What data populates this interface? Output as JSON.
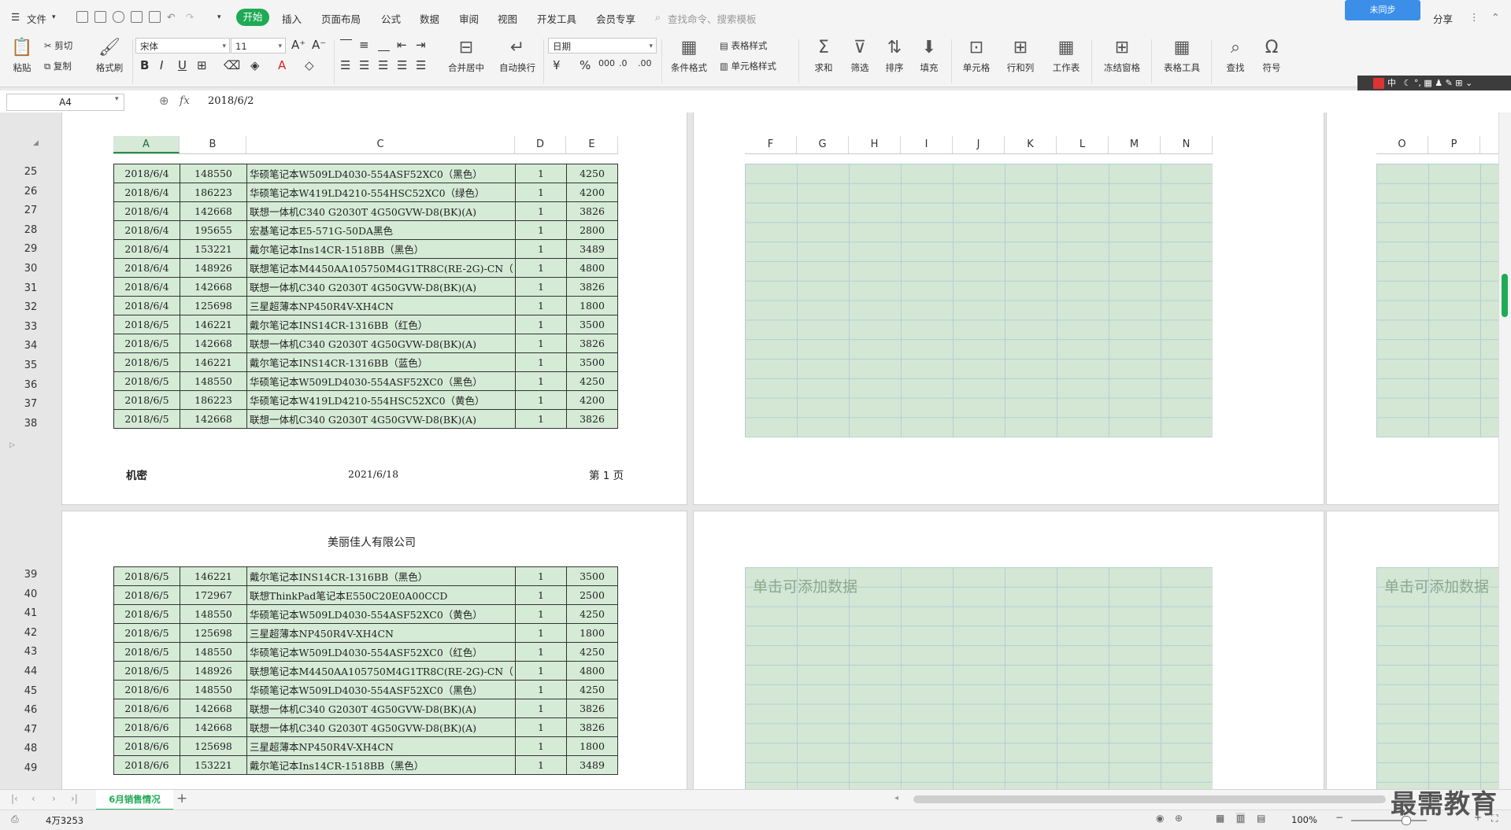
{
  "menubar": {
    "file_label": "文件",
    "tabs": [
      "开始",
      "插入",
      "页面布局",
      "公式",
      "数据",
      "审阅",
      "视图",
      "开发工具",
      "会员专享"
    ],
    "active_tab": "开始",
    "search_placeholder": "查找命令、搜索模板",
    "cloud_label": "未同步",
    "share_label": "分享"
  },
  "ribbon": {
    "paste": "粘贴",
    "cut": "剪切",
    "copy": "复制",
    "format_painter": "格式刷",
    "font_name": "宋体",
    "font_size": "11",
    "merge_center": "合并居中",
    "wrap_text": "自动换行",
    "number_format": "日期",
    "conditional_format": "条件格式",
    "table_style": "表格样式",
    "cell_style": "单元格样式",
    "sum": "求和",
    "filter": "筛选",
    "sort": "排序",
    "fill": "填充",
    "cell": "单元格",
    "rowcol": "行和列",
    "worksheet": "工作表",
    "freeze": "冻结窗格",
    "table_tools": "表格工具",
    "find": "查找",
    "symbol": "符号"
  },
  "ime": {
    "label": "中"
  },
  "formula_bar": {
    "name_box": "A4",
    "fx": "fx",
    "value": "2018/6/2"
  },
  "columns_left": [
    "A",
    "B",
    "C",
    "D",
    "E"
  ],
  "columns_mid": [
    "F",
    "G",
    "H",
    "I",
    "J",
    "K",
    "L",
    "M",
    "N"
  ],
  "columns_right": [
    "O",
    "P"
  ],
  "page1": {
    "rows": [
      {
        "n": "25",
        "date": "2018/6/4",
        "code": "148550",
        "name": "华硕笔记本W509LD4030-554ASF52XC0（黑色）",
        "qty": "1",
        "price": "4250"
      },
      {
        "n": "26",
        "date": "2018/6/4",
        "code": "186223",
        "name": "华硕笔记本W419LD4210-554HSC52XC0（绿色）",
        "qty": "1",
        "price": "4200"
      },
      {
        "n": "27",
        "date": "2018/6/4",
        "code": "142668",
        "name": "联想一体机C340 G2030T 4G50GVW-D8(BK)(A)",
        "qty": "1",
        "price": "3826"
      },
      {
        "n": "28",
        "date": "2018/6/4",
        "code": "195655",
        "name": "宏基笔记本E5-571G-50DA黑色",
        "qty": "1",
        "price": "2800"
      },
      {
        "n": "29",
        "date": "2018/6/4",
        "code": "153221",
        "name": "戴尔笔记本Ins14CR-1518BB（黑色）",
        "qty": "1",
        "price": "3489"
      },
      {
        "n": "30",
        "date": "2018/6/4",
        "code": "148926",
        "name": "联想笔记本M4450AA105750M4G1TR8C(RE-2G)-CN（",
        "qty": "1",
        "price": "4800"
      },
      {
        "n": "31",
        "date": "2018/6/4",
        "code": "142668",
        "name": "联想一体机C340 G2030T 4G50GVW-D8(BK)(A)",
        "qty": "1",
        "price": "3826"
      },
      {
        "n": "32",
        "date": "2018/6/4",
        "code": "125698",
        "name": "三星超薄本NP450R4V-XH4CN",
        "qty": "1",
        "price": "1800"
      },
      {
        "n": "33",
        "date": "2018/6/5",
        "code": "146221",
        "name": "戴尔笔记本INS14CR-1316BB（红色）",
        "qty": "1",
        "price": "3500"
      },
      {
        "n": "34",
        "date": "2018/6/5",
        "code": "142668",
        "name": "联想一体机C340 G2030T 4G50GVW-D8(BK)(A)",
        "qty": "1",
        "price": "3826"
      },
      {
        "n": "35",
        "date": "2018/6/5",
        "code": "146221",
        "name": "戴尔笔记本INS14CR-1316BB（蓝色）",
        "qty": "1",
        "price": "3500"
      },
      {
        "n": "36",
        "date": "2018/6/5",
        "code": "148550",
        "name": "华硕笔记本W509LD4030-554ASF52XC0（黑色）",
        "qty": "1",
        "price": "4250"
      },
      {
        "n": "37",
        "date": "2018/6/5",
        "code": "186223",
        "name": "华硕笔记本W419LD4210-554HSC52XC0（黄色）",
        "qty": "1",
        "price": "4200"
      },
      {
        "n": "38",
        "date": "2018/6/5",
        "code": "142668",
        "name": "联想一体机C340 G2030T 4G50GVW-D8(BK)(A)",
        "qty": "1",
        "price": "3826"
      }
    ],
    "footer_left": "机密",
    "footer_center": "2021/6/18",
    "footer_right": "第 1 页"
  },
  "page2": {
    "header": "美丽佳人有限公司",
    "rows": [
      {
        "n": "39",
        "date": "2018/6/5",
        "code": "146221",
        "name": "戴尔笔记本INS14CR-1316BB（黑色）",
        "qty": "1",
        "price": "3500"
      },
      {
        "n": "40",
        "date": "2018/6/5",
        "code": "172967",
        "name": "联想ThinkPad笔记本E550C20E0A00CCD",
        "qty": "1",
        "price": "2500"
      },
      {
        "n": "41",
        "date": "2018/6/5",
        "code": "148550",
        "name": "华硕笔记本W509LD4030-554ASF52XC0（黄色）",
        "qty": "1",
        "price": "4250"
      },
      {
        "n": "42",
        "date": "2018/6/5",
        "code": "125698",
        "name": "三星超薄本NP450R4V-XH4CN",
        "qty": "1",
        "price": "1800"
      },
      {
        "n": "43",
        "date": "2018/6/5",
        "code": "148550",
        "name": "华硕笔记本W509LD4030-554ASF52XC0（红色）",
        "qty": "1",
        "price": "4250"
      },
      {
        "n": "44",
        "date": "2018/6/5",
        "code": "148926",
        "name": "联想笔记本M4450AA105750M4G1TR8C(RE-2G)-CN（",
        "qty": "1",
        "price": "4800"
      },
      {
        "n": "45",
        "date": "2018/6/6",
        "code": "148550",
        "name": "华硕笔记本W509LD4030-554ASF52XC0（黑色）",
        "qty": "1",
        "price": "4250"
      },
      {
        "n": "46",
        "date": "2018/6/6",
        "code": "142668",
        "name": "联想一体机C340 G2030T 4G50GVW-D8(BK)(A)",
        "qty": "1",
        "price": "3826"
      },
      {
        "n": "47",
        "date": "2018/6/6",
        "code": "142668",
        "name": "联想一体机C340 G2030T 4G50GVW-D8(BK)(A)",
        "qty": "1",
        "price": "3826"
      },
      {
        "n": "48",
        "date": "2018/6/6",
        "code": "125698",
        "name": "三星超薄本NP450R4V-XH4CN",
        "qty": "1",
        "price": "1800"
      },
      {
        "n": "49",
        "date": "2018/6/6",
        "code": "153221",
        "name": "戴尔笔记本Ins14CR-1518BB（黑色）",
        "qty": "1",
        "price": "3489"
      }
    ]
  },
  "placeholder": "单击可添加数据",
  "sheet_tab": "6月销售情况",
  "status": {
    "sum": "4万3253",
    "zoom": "100%"
  },
  "watermark": "最需教育",
  "colors": {
    "accent": "#1faa55",
    "cell_fill": "#d5ebd6"
  }
}
